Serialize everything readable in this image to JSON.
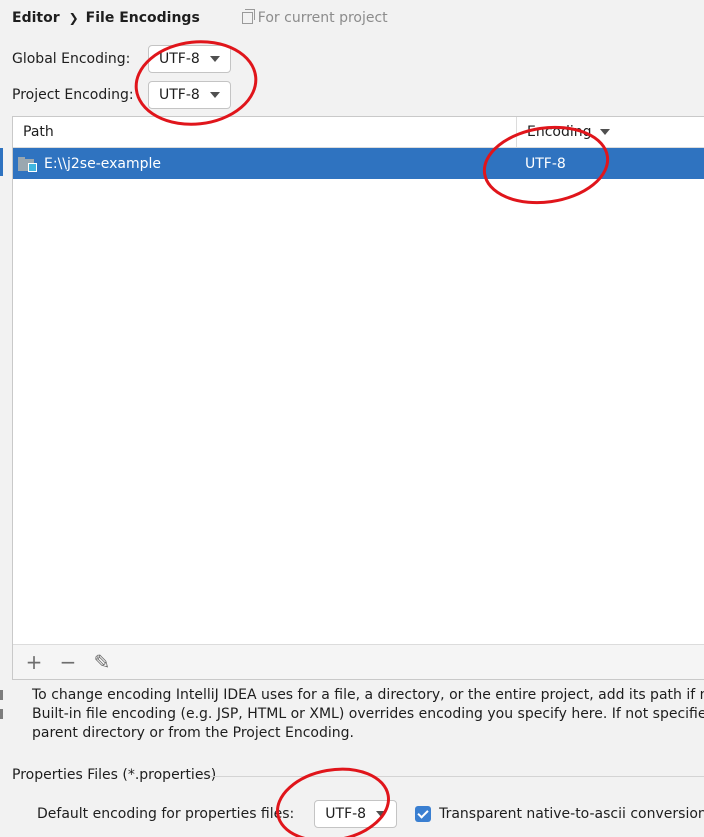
{
  "breadcrumb": {
    "parent": "Editor",
    "current": "File Encodings",
    "scope_label": "For current project",
    "scope_icon": "copy-icon"
  },
  "global_encoding": {
    "label": "Global Encoding:",
    "value": "UTF-8"
  },
  "project_encoding": {
    "label": "Project Encoding:",
    "value": "UTF-8"
  },
  "table": {
    "columns": [
      "Path",
      "Encoding"
    ],
    "rows": [
      {
        "path": "E:\\\\j2se-example",
        "encoding": "UTF-8",
        "icon": "folder-icon",
        "selected": true
      }
    ],
    "selection_color": "#2f73c0"
  },
  "toolbar": {
    "add_icon": "+",
    "remove_icon": "−",
    "edit_icon": "✎"
  },
  "help_text": [
    "To change encoding IntelliJ IDEA uses for a file, a directory, or the entire project, add its path if nece",
    "Built-in file encoding (e.g. JSP, HTML or XML) overrides encoding you specify here. If not specified, f",
    "parent directory or from the Project Encoding."
  ],
  "properties": {
    "section_title": "Properties Files (*.properties)",
    "default_label": "Default encoding for properties files:",
    "default_value": "UTF-8",
    "transparent_label": "Transparent native-to-ascii conversion",
    "transparent_checked": true
  },
  "annotation_color": "#e0151b"
}
